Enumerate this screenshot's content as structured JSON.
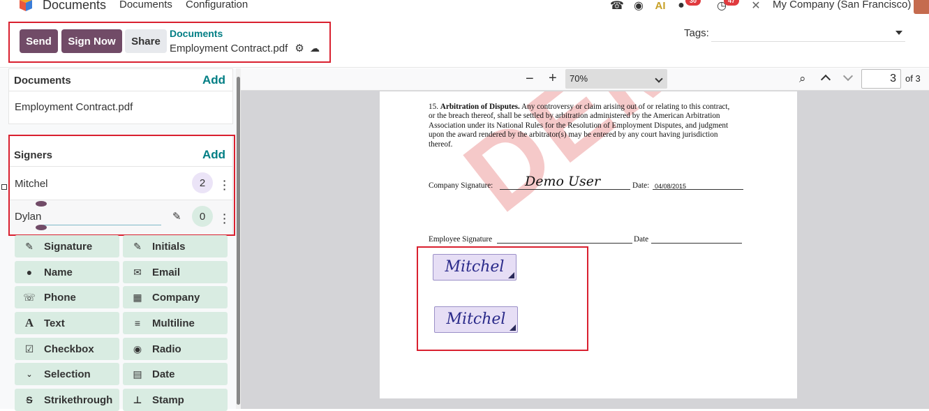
{
  "topnav": {
    "app_title": "Documents",
    "menu": [
      "Documents",
      "Configuration"
    ],
    "badges": {
      "messages": "30",
      "activities": "47"
    },
    "company": "My Company (San Francisco)"
  },
  "control": {
    "send_label": "Send",
    "sign_now_label": "Sign Now",
    "share_label": "Share",
    "breadcrumb_parent": "Documents",
    "breadcrumb_current": "Employment Contract.pdf",
    "tags_label": "Tags:"
  },
  "sidebar": {
    "documents": {
      "title": "Documents",
      "add_label": "Add",
      "items": [
        "Employment Contract.pdf"
      ]
    },
    "signers": {
      "title": "Signers",
      "add_label": "Add",
      "items": [
        {
          "name": "Mitchel",
          "count": "2"
        },
        {
          "name": "Dylan",
          "count": "0"
        }
      ]
    },
    "fields": [
      {
        "label": "Signature",
        "icon": "edit-icon"
      },
      {
        "label": "Initials",
        "icon": "edit-icon"
      },
      {
        "label": "Name",
        "icon": "user-icon"
      },
      {
        "label": "Email",
        "icon": "envelope-icon"
      },
      {
        "label": "Phone",
        "icon": "phone-icon"
      },
      {
        "label": "Company",
        "icon": "building-icon"
      },
      {
        "label": "Text",
        "icon": "font-icon"
      },
      {
        "label": "Multiline",
        "icon": "bars-icon"
      },
      {
        "label": "Checkbox",
        "icon": "checkbox-icon"
      },
      {
        "label": "Radio",
        "icon": "radio-icon"
      },
      {
        "label": "Selection",
        "icon": "chevron-down-icon"
      },
      {
        "label": "Date",
        "icon": "calendar-icon"
      },
      {
        "label": "Strikethrough",
        "icon": "strikethrough-icon"
      },
      {
        "label": "Stamp",
        "icon": "stamp-icon"
      }
    ]
  },
  "viewer": {
    "zoom": "70%",
    "page_current": "3",
    "page_total": "of 3",
    "watermark": "DEMO",
    "clause_number": "15.",
    "clause_title": "Arbitration of Disputes.",
    "clause_lines": [
      "Any controversy or claim arising out of or relating to this contract,",
      "or the breach thereof, shall be settled by arbitration administered by the American Arbitration",
      "Association under its National Rules for the Resolution of Employment Disputes, and judgment",
      "upon the award rendered by the arbitrator(s) may be entered by any court having jurisdiction",
      "thereof."
    ],
    "company_signature_label": "Company Signature:",
    "company_signature_value": "Demo User",
    "date_label": "Date:",
    "date_value": "04/08/2015",
    "employee_signature_label": "Employee Signature",
    "employee_date_label": "Date",
    "signature_fields": [
      "Mitchel",
      "Mitchel"
    ]
  }
}
